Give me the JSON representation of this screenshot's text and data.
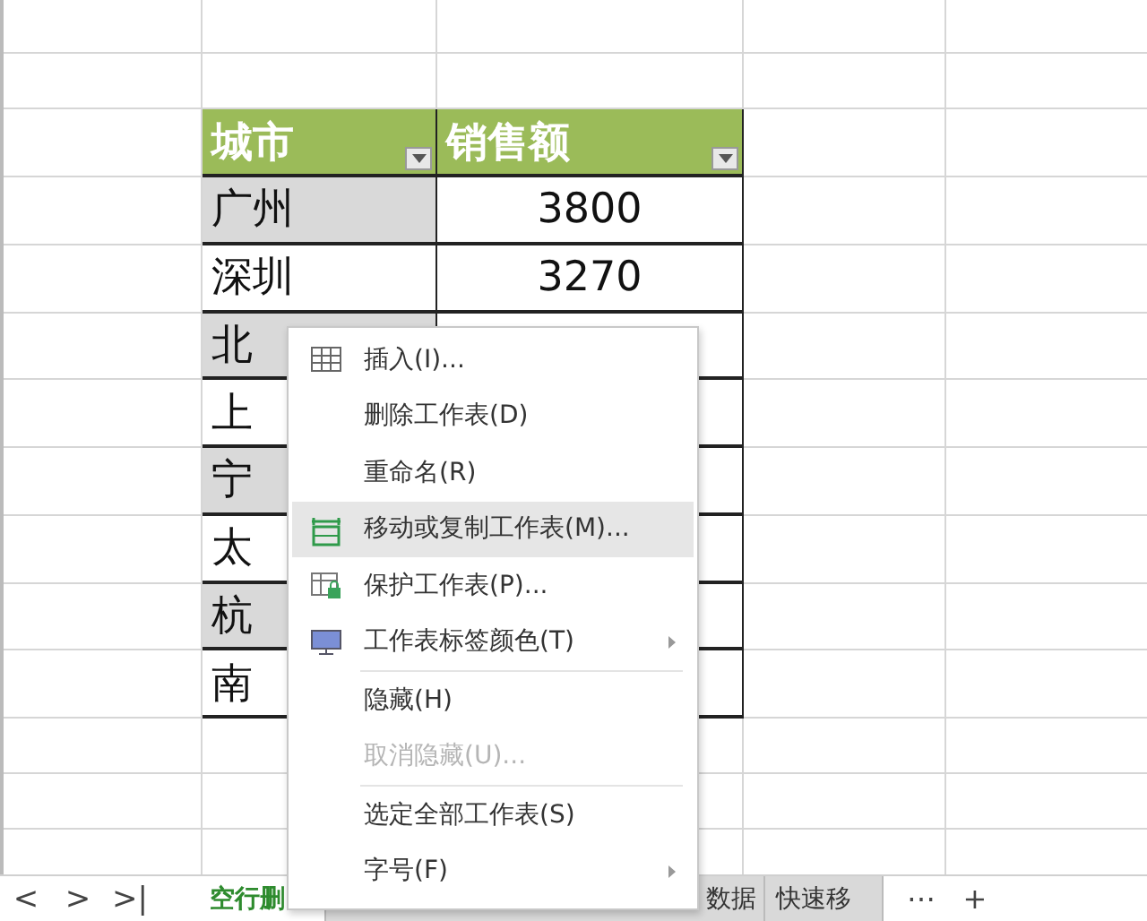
{
  "table": {
    "columns": [
      {
        "label": "城市"
      },
      {
        "label": "销售额"
      }
    ],
    "rows": [
      {
        "city": "广州",
        "sales": "3800",
        "shaded": true
      },
      {
        "city": "深圳",
        "sales": "3270",
        "shaded": false
      },
      {
        "city": "北",
        "shaded": true
      },
      {
        "city": "上",
        "shaded": false
      },
      {
        "city": "宁",
        "shaded": true
      },
      {
        "city": "太",
        "shaded": false
      },
      {
        "city": "杭",
        "shaded": true
      },
      {
        "city": "南",
        "shaded": false
      }
    ]
  },
  "context_menu": {
    "items": [
      {
        "kind": "item",
        "label": "插入(I)...",
        "selected": false,
        "disabled": false,
        "submenu": false
      },
      {
        "kind": "item",
        "label": "删除工作表(D)",
        "selected": false,
        "disabled": false,
        "submenu": false
      },
      {
        "kind": "item",
        "label": "重命名(R)",
        "selected": false,
        "disabled": false,
        "submenu": false
      },
      {
        "kind": "item",
        "label": "移动或复制工作表(M)...",
        "selected": true,
        "disabled": false,
        "submenu": false
      },
      {
        "kind": "item",
        "label": "保护工作表(P)...",
        "selected": false,
        "disabled": false,
        "submenu": false
      },
      {
        "kind": "item",
        "label": "工作表标签颜色(T)",
        "selected": false,
        "disabled": false,
        "submenu": true
      },
      {
        "kind": "separator"
      },
      {
        "kind": "item",
        "label": "隐藏(H)",
        "selected": false,
        "disabled": false,
        "submenu": false
      },
      {
        "kind": "item",
        "label": "取消隐藏(U)...",
        "selected": false,
        "disabled": true,
        "submenu": false
      },
      {
        "kind": "separator"
      },
      {
        "kind": "item",
        "label": "选定全部工作表(S)",
        "selected": false,
        "disabled": false,
        "submenu": false
      },
      {
        "kind": "item",
        "label": "字号(F)",
        "selected": false,
        "disabled": false,
        "submenu": true
      }
    ]
  },
  "sheet_tabs": {
    "nav": [
      "<",
      ">",
      ">|"
    ],
    "tabs": [
      {
        "label": "空行删",
        "selected": true
      },
      {
        "label": "数据",
        "selected": false
      },
      {
        "label": "快速移",
        "selected": false
      }
    ],
    "more": "⋯",
    "add": "+"
  }
}
